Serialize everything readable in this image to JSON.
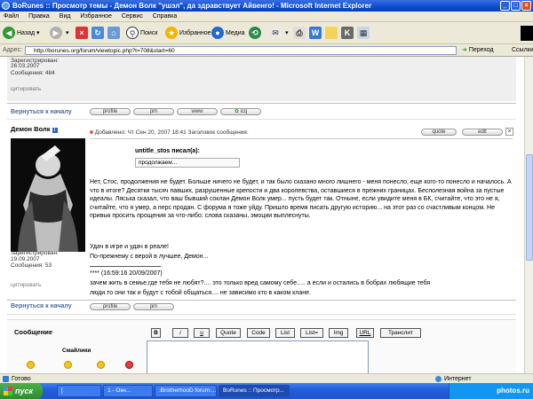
{
  "window": {
    "title": "BoRunes :: Просмотр темы - Демон Волк \"ушэл\", да здравствует Айвенго! - Microsoft Internet Explorer"
  },
  "menu": [
    "Файл",
    "Правка",
    "Вид",
    "Избранное",
    "Сервис",
    "Справка"
  ],
  "toolbar": {
    "back": "Назад",
    "search": "Поиск",
    "favorites": "Избранное",
    "media": "Медиа"
  },
  "address": {
    "label": "Адрес:",
    "url": "http://borunes.org/forum/viewtopic.php?t=708&start=60",
    "go": "Переход",
    "links": "Ссылки"
  },
  "post1": {
    "reg_label": "Зарегистрирован:",
    "reg_date": "26.03.2007",
    "posts": "Сообщения: 484",
    "quote_link": "цитировать"
  },
  "nav": {
    "back_top": "Вернуться к началу",
    "profile": "profile",
    "pm": "pm",
    "www": "www",
    "icq": "icq"
  },
  "post2": {
    "author": "Демон Волк",
    "header": "Добавлено: Чт Сен 20, 2007 18:41    Заголовок сообщения:",
    "quote_btn": "quote",
    "edit_btn": "edit",
    "quote_author": "untitle_stos писал(а):",
    "quote_text": "продолжаем...",
    "para1": "Нет, Стос, продолжения не будет. Больше ничего не будет, и так было сказано много лишнего - меня понесло, еще кого-то понесло и началось. А что в итоге? Десятки тысяч павших, разрушенные крепости и два королевства, оставшиеся в прежних границах. Бесполезная война за пустые идеалы. Ляська сказал, что ваш бывший соклан Демон Волк умер... пусть будет так. Отныне, если увидите меня в БК, считайте, что это не я, считайте, что я умер, а перс продан. С форума я тоже уйду. Пришло время писать другую историю... на этот раз со счастливым концом. Не привык просить прощения за что-либо: слова сказаны, эмоции выплеснуты.",
    "para2a": "Удач в игре и удач в реале!",
    "para2b": "По-прежнему с верой в лучшее, Демон...",
    "sig_date": "**** (16:59:16 20/09/2007)",
    "sig1": "зачем жить в семье,где тебя не любят?.... это только вред самому себе..... а если и остались в бобрах любящие тебя",
    "sig2": "люди.то они так и будут с тобой общаться.... не зависимо кто в каком клане.",
    "reg_label": "Зарегистрирован:",
    "reg_date": "19.09.2007",
    "posts": "Сообщения: 53",
    "quote_link": "цитировать"
  },
  "reply": {
    "label": "Сообщение",
    "smileys": "Смайлики",
    "buttons": [
      "B",
      "i",
      "u",
      "Quote",
      "Code",
      "List",
      "List=",
      "Img",
      "URL",
      "Транслит"
    ]
  },
  "status": {
    "text": "Готово",
    "zone": "Интернет"
  },
  "taskbar": {
    "start": "пуск",
    "tasks": [
      "[",
      "1 - Окн...",
      ":BrotherhooD forum:...",
      "BoRunes :: Просмотр..."
    ],
    "watermark": "photos.ru"
  }
}
